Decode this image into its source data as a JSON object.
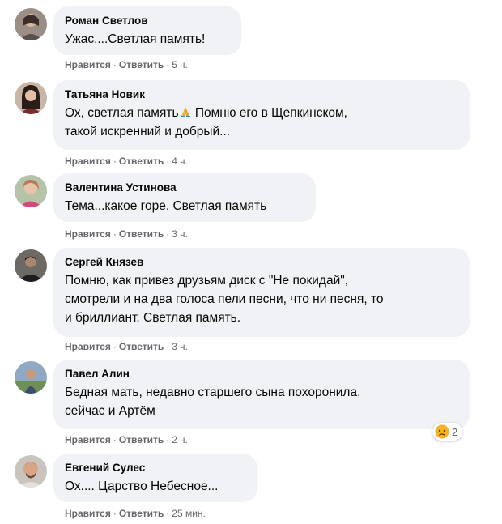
{
  "comments": [
    {
      "author": "Роман Светлов",
      "text": "Ужас....Светлая память!",
      "like_label": "Нравится",
      "reply_label": "Ответить",
      "separator": "·",
      "time": "5 ч.",
      "avatar_icon": "avatar-photo"
    },
    {
      "author": "Татьяна Новик",
      "text_part1": "Ох, светлая память",
      "text_emoji": "folded-hands-emoji",
      "text_part2": " Помню его в Щепкинском,\nтакой искренний и добрый...",
      "like_label": "Нравится",
      "reply_label": "Ответить",
      "separator": "·",
      "time": "4 ч.",
      "avatar_icon": "avatar-photo"
    },
    {
      "author": "Валентина Устинова",
      "text": "Тема...какое горе. Светлая память",
      "like_label": "Нравится",
      "reply_label": "Ответить",
      "separator": "·",
      "time": "3 ч.",
      "avatar_icon": "avatar-photo"
    },
    {
      "author": "Сергей Князев",
      "text": "Помню, как привез друзьям диск с \"Не покидай\",\nсмотрели и на два голоса пели песни, что ни песня, то\nи бриллиант. Светлая память.",
      "like_label": "Нравится",
      "reply_label": "Ответить",
      "separator": "·",
      "time": "3 ч.",
      "avatar_icon": "avatar-photo"
    },
    {
      "author": "Павел Алин",
      "text": "Бедная мать, недавно старшего сына похоронила,\nсейчас и Артём",
      "like_label": "Нравится",
      "reply_label": "Ответить",
      "separator": "·",
      "time": "2 ч.",
      "avatar_icon": "avatar-photo",
      "reaction": {
        "icon": "sad-reaction-icon",
        "count": "2"
      }
    },
    {
      "author": "Евгений Сулес",
      "text": "Ох.... Царство Небесное...",
      "like_label": "Нравится",
      "reply_label": "Ответить",
      "separator": "·",
      "time": "25 мин.",
      "avatar_icon": "avatar-photo"
    }
  ],
  "colors": {
    "bubble": "#f0f2f5",
    "meta_text": "#65676b",
    "text": "#050505",
    "reaction_face": "#f7b125"
  }
}
